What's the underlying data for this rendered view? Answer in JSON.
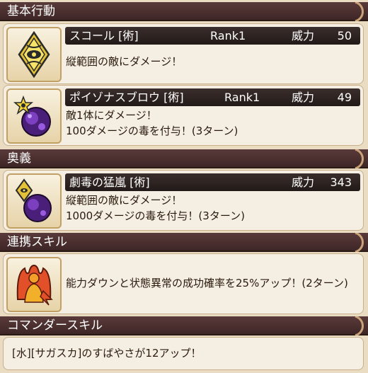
{
  "sections": {
    "basic": "基本行動",
    "ougi": "奥義",
    "renkei": "連携スキル",
    "commander": "コマンダースキル"
  },
  "skills": [
    {
      "name": "スコール [術]",
      "rank": "Rank1",
      "power_label": "威力",
      "power": "50",
      "lines": [
        "縦範囲の敵にダメージ！"
      ]
    },
    {
      "name": "ポイゾナスブロウ [術]",
      "rank": "Rank1",
      "power_label": "威力",
      "power": "49",
      "lines": [
        "敵1体にダメージ！",
        "100ダメージの毒を付与！(3ターン)"
      ]
    },
    {
      "name": "劇毒の猛嵐 [術]",
      "power_label": "威力",
      "power": "343",
      "lines": [
        "縦範囲の敵にダメージ！",
        "1000ダメージの毒を付与！(3ターン)"
      ]
    }
  ],
  "renkei": {
    "text": "能力ダウンと状態異常の成功確率を25%アップ！(2ターン)"
  },
  "commander": {
    "text": "[水][サガスカ]のすばやさが12アップ！"
  },
  "icons": {
    "skill1": "water-eye-icon",
    "skill2": "poison-orb-icon",
    "skill3": "water-poison-icon",
    "renkei": "figure-aura-icon"
  },
  "colors": {
    "header": "#4a2f2f",
    "card": "#f5efe3",
    "title_bar": "#2c2220",
    "accent_gold": "#d7b13a",
    "poison_purple": "#5a2a8a"
  }
}
